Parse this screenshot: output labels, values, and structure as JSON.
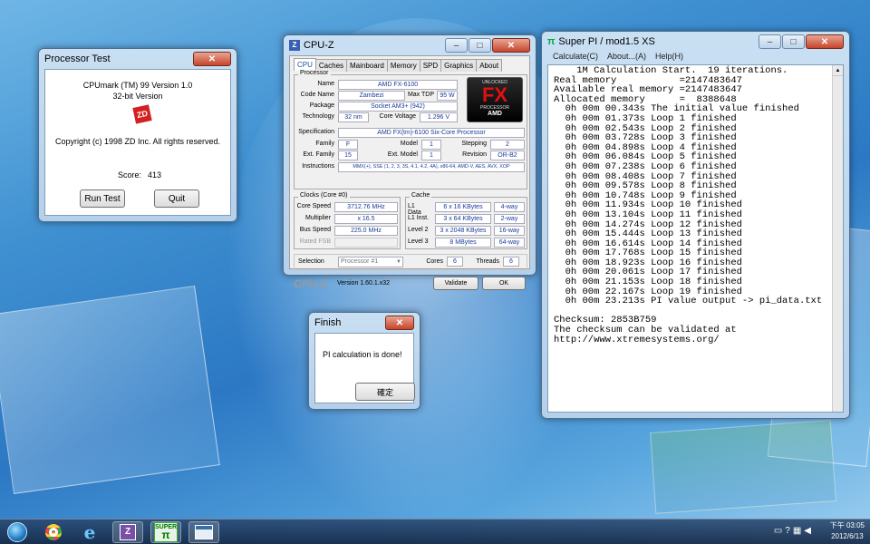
{
  "processor_test": {
    "title": "Processor Test",
    "product": "CPUmark (TM) 99 Version 1.0",
    "bitness": "32-bit Version",
    "logo_text": "ZD",
    "copyright": "Copyright (c) 1998 ZD Inc. All rights reserved.",
    "score_label": "Score:",
    "score_value": "413",
    "run_button": "Run Test",
    "quit_button": "Quit"
  },
  "cpuz": {
    "title": "CPU-Z",
    "tabs": [
      "CPU",
      "Caches",
      "Mainboard",
      "Memory",
      "SPD",
      "Graphics",
      "About"
    ],
    "processor_group": "Processor",
    "name_label": "Name",
    "name": "AMD FX-6100",
    "codename_label": "Code Name",
    "codename": "Zambezi",
    "maxtdp_label": "Max TDP",
    "maxtdp": "95 W",
    "package_label": "Package",
    "package": "Socket AM3+ (942)",
    "technology_label": "Technology",
    "technology": "32 nm",
    "corevoltage_label": "Core Voltage",
    "corevoltage": "1.296 V",
    "spec_label": "Specification",
    "spec": "AMD FX(tm)-6100 Six-Core Processor",
    "family_label": "Family",
    "family": "F",
    "model_label": "Model",
    "model": "1",
    "stepping_label": "Stepping",
    "stepping": "2",
    "extfamily_label": "Ext. Family",
    "extfamily": "15",
    "extmodel_label": "Ext. Model",
    "extmodel": "1",
    "revision_label": "Revision",
    "revision": "OR-B2",
    "instructions_label": "Instructions",
    "instructions": "MMX(+), SSE (1, 2, 3, 3S, 4.1, 4.2, 4A), x86-64, AMD-V, AES, AVX, XOP",
    "clocks_group": "Clocks (Core #0)",
    "corespeed_label": "Core Speed",
    "corespeed": "3712.76 MHz",
    "multiplier_label": "Multiplier",
    "multiplier": "x 16.5",
    "busspeed_label": "Bus Speed",
    "busspeed": "225.0 MHz",
    "ratedfsb_label": "Rated FSB",
    "ratedfsb": "",
    "cache_group": "Cache",
    "l1data_label": "L1 Data",
    "l1data": "6 x 16 KBytes",
    "l1data_way": "4-way",
    "l1inst_label": "L1 Inst.",
    "l1inst": "3 x 64 KBytes",
    "l1inst_way": "2-way",
    "level2_label": "Level 2",
    "level2": "3 x 2048 KBytes",
    "level2_way": "16-way",
    "level3_label": "Level 3",
    "level3": "8 MBytes",
    "level3_way": "64-way",
    "selection_label": "Selection",
    "selection": "Processor #1",
    "cores_label": "Cores",
    "cores": "6",
    "threads_label": "Threads",
    "threads": "6",
    "brand": "CPU-Z",
    "version": "Version 1.60.1.x32",
    "validate_button": "Validate",
    "ok_button": "OK",
    "logo_top": "UNLOCKED",
    "logo_main": "FX",
    "logo_sub": "PROCESSOR",
    "logo_brand": "AMD"
  },
  "superpi": {
    "title": "Super PI / mod1.5 XS",
    "menu": [
      "Calculate(C)",
      "About...(A)",
      "Help(H)"
    ],
    "output": "    1M Calculation Start.  19 iterations.\nReal memory           =2147483647\nAvailable real memory =2147483647\nAllocated memory      =  8388648\n  0h 00m 00.343s The initial value finished\n  0h 00m 01.373s Loop 1 finished\n  0h 00m 02.543s Loop 2 finished\n  0h 00m 03.728s Loop 3 finished\n  0h 00m 04.898s Loop 4 finished\n  0h 00m 06.084s Loop 5 finished\n  0h 00m 07.238s Loop 6 finished\n  0h 00m 08.408s Loop 7 finished\n  0h 00m 09.578s Loop 8 finished\n  0h 00m 10.748s Loop 9 finished\n  0h 00m 11.934s Loop 10 finished\n  0h 00m 13.104s Loop 11 finished\n  0h 00m 14.274s Loop 12 finished\n  0h 00m 15.444s Loop 13 finished\n  0h 00m 16.614s Loop 14 finished\n  0h 00m 17.768s Loop 15 finished\n  0h 00m 18.923s Loop 16 finished\n  0h 00m 20.061s Loop 17 finished\n  0h 00m 21.153s Loop 18 finished\n  0h 00m 22.167s Loop 19 finished\n  0h 00m 23.213s PI value output -> pi_data.txt\n\nChecksum: 2853B759\nThe checksum can be validated at\nhttp://www.xtremesystems.org/"
  },
  "finish": {
    "title": "Finish",
    "message": "PI calculation is done!",
    "ok_button": "確定"
  },
  "taskbar": {
    "superpi_label_1": "SUPER",
    "superpi_label_2": "π",
    "ie_glyph": "e",
    "time": "下午 03:05",
    "date": "2012/6/13"
  }
}
